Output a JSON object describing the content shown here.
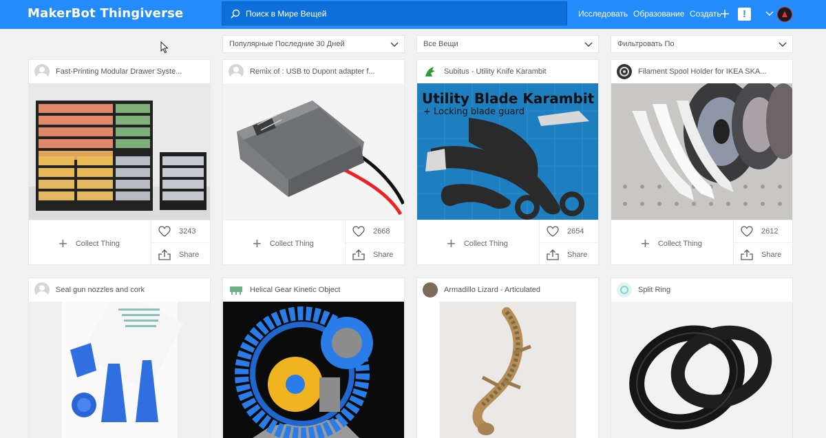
{
  "header": {
    "logo_maker": "MakerBot",
    "logo_thing": "Thingiverse",
    "search_placeholder": "Поиск в Мире Вещей",
    "nav_explore": "Исследовать",
    "nav_education": "Образование",
    "nav_create": "Создать",
    "alert": "!",
    "colors": {
      "brand": "#248bfb",
      "search_bg": "#0d6fd9"
    }
  },
  "filters": {
    "sort": "Популярные Последние 30 Дней",
    "type": "Все Вещи",
    "filter": "Фильтровать По"
  },
  "actions": {
    "collect": "Collect Thing",
    "share": "Share"
  },
  "cards": [
    {
      "title": "Fast-Printing Modular Drawer Syste...",
      "likes": "3243",
      "avatar": "default-avatar-icon"
    },
    {
      "title": "Remix of : USB to Dupont adapter f...",
      "likes": "2668",
      "avatar": "default-avatar-icon"
    },
    {
      "title": "Subitus - Utility Knife Karambit",
      "likes": "2654",
      "avatar": "dragon-avatar-icon"
    },
    {
      "title": "Filament Spool Holder for IKEA SKA...",
      "likes": "2612",
      "avatar": "spool-avatar-icon"
    },
    {
      "title": "Seal gun nozzles and cork",
      "avatar": "default-avatar-icon"
    },
    {
      "title": "Helical Gear Kinetic Object",
      "avatar": "gear-avatar-icon"
    },
    {
      "title": "Armadillo Lizard - Articulated",
      "avatar": "photo-avatar-icon"
    },
    {
      "title": "Split Ring",
      "avatar": "ring-avatar-icon"
    }
  ],
  "images": {
    "karambit_title": "Utility Blade Karambit",
    "karambit_sub": "+ Locking blade guard"
  }
}
